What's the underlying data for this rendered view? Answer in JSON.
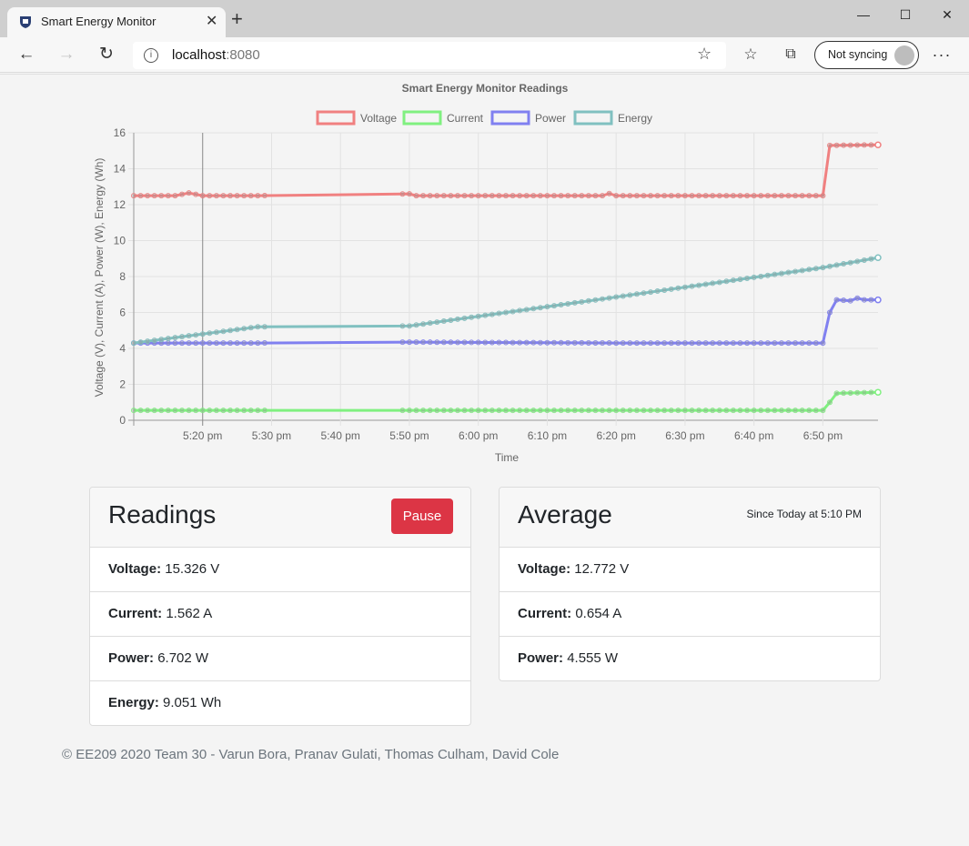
{
  "browser": {
    "tab_title": "Smart Energy Monitor",
    "url_host": "localhost",
    "url_port": ":8080",
    "sync_label": "Not syncing"
  },
  "chart_data": {
    "type": "line",
    "title": "Smart Energy Monitor Readings",
    "xlabel": "Time",
    "ylabel": "Voltage (V), Current (A), Power (W), Energy (Wh)",
    "ylim": [
      0,
      16
    ],
    "yticks": [
      "0",
      "2",
      "4",
      "6",
      "8",
      "10",
      "12",
      "14",
      "16"
    ],
    "xticks": [
      "5:20 pm",
      "5:30 pm",
      "5:40 pm",
      "5:50 pm",
      "6:00 pm",
      "6:10 pm",
      "6:20 pm",
      "6:30 pm",
      "6:40 pm",
      "6:50 pm"
    ],
    "x_range_minutes": [
      "17:10",
      "18:58"
    ],
    "grid": true,
    "legend_position": "top",
    "series": [
      {
        "name": "Voltage",
        "color": "#f08080",
        "points": [
          [
            "17:10",
            12.5
          ],
          [
            "17:16",
            12.5
          ],
          [
            "17:18",
            12.65
          ],
          [
            "17:20",
            12.5
          ],
          [
            "17:28",
            12.5
          ],
          [
            "17:50",
            12.6
          ],
          [
            "17:51",
            12.5
          ],
          [
            "18:18",
            12.5
          ],
          [
            "18:19",
            12.62
          ],
          [
            "18:20",
            12.5
          ],
          [
            "18:50",
            12.5
          ],
          [
            "18:51",
            15.3
          ],
          [
            "18:58",
            15.33
          ]
        ]
      },
      {
        "name": "Current",
        "color": "#80f080",
        "points": [
          [
            "17:10",
            0.55
          ],
          [
            "17:28",
            0.55
          ],
          [
            "17:50",
            0.55
          ],
          [
            "18:50",
            0.55
          ],
          [
            "18:51",
            1.0
          ],
          [
            "18:52",
            1.5
          ],
          [
            "18:58",
            1.56
          ]
        ]
      },
      {
        "name": "Power",
        "color": "#8080f0",
        "points": [
          [
            "17:10",
            4.3
          ],
          [
            "17:28",
            4.3
          ],
          [
            "17:50",
            4.35
          ],
          [
            "18:20",
            4.3
          ],
          [
            "18:50",
            4.3
          ],
          [
            "18:51",
            6.0
          ],
          [
            "18:52",
            6.7
          ],
          [
            "18:54",
            6.65
          ],
          [
            "18:55",
            6.8
          ],
          [
            "18:56",
            6.7
          ],
          [
            "18:58",
            6.7
          ]
        ]
      },
      {
        "name": "Energy",
        "color": "#80c0c0",
        "points": [
          [
            "17:10",
            4.3
          ],
          [
            "17:28",
            5.2
          ],
          [
            "17:50",
            5.25
          ],
          [
            "18:18",
            6.75
          ],
          [
            "18:50",
            8.5
          ],
          [
            "18:58",
            9.05
          ]
        ]
      }
    ]
  },
  "readings": {
    "title": "Readings",
    "pause_label": "Pause",
    "rows": [
      {
        "label": "Voltage:",
        "value": "15.326 V"
      },
      {
        "label": "Current:",
        "value": "1.562 A"
      },
      {
        "label": "Power:",
        "value": "6.702 W"
      },
      {
        "label": "Energy:",
        "value": "9.051 Wh"
      }
    ]
  },
  "average": {
    "title": "Average",
    "since": "Since Today at 5:10 PM",
    "rows": [
      {
        "label": "Voltage:",
        "value": "12.772 V"
      },
      {
        "label": "Current:",
        "value": "0.654 A"
      },
      {
        "label": "Power:",
        "value": "4.555 W"
      }
    ]
  },
  "footer": "© EE209 2020 Team 30 - Varun Bora, Pranav Gulati, Thomas Culham, David Cole"
}
